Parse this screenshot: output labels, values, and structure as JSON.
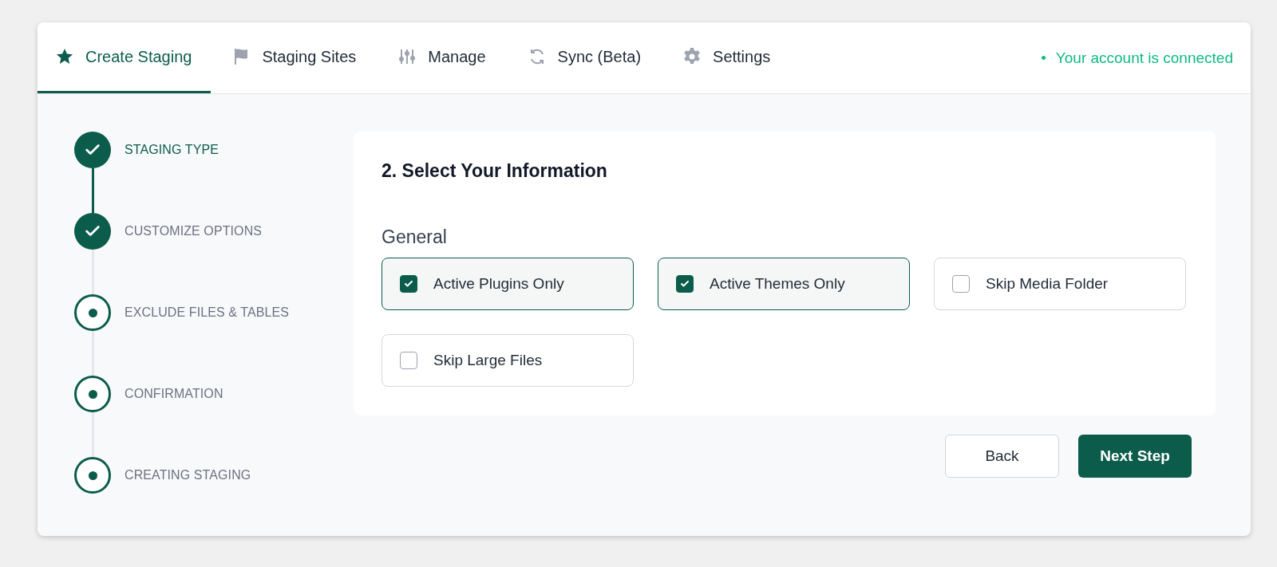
{
  "tabs": [
    {
      "label": "Create Staging",
      "selected": true
    },
    {
      "label": "Staging Sites",
      "selected": false
    },
    {
      "label": "Manage",
      "selected": false
    },
    {
      "label": "Sync (Beta)",
      "selected": false
    },
    {
      "label": "Settings",
      "selected": false
    }
  ],
  "connection_status": {
    "bullet": "•",
    "label": "Your account is connected"
  },
  "steps": [
    {
      "label": "STAGING TYPE",
      "done": true,
      "selected": true
    },
    {
      "label": "CUSTOMIZE OPTIONS",
      "done": true,
      "selected": false
    },
    {
      "label": "EXCLUDE FILES & TABLES",
      "done": false,
      "selected": false
    },
    {
      "label": "CONFIRMATION",
      "done": false,
      "selected": false
    },
    {
      "label": "CREATING STAGING",
      "done": false,
      "selected": false
    }
  ],
  "panel": {
    "title": "2. Select Your Information",
    "section": "General",
    "options": [
      {
        "label": "Active Plugins Only",
        "checked": true
      },
      {
        "label": "Active Themes Only",
        "checked": true
      },
      {
        "label": "Skip Media Folder",
        "checked": false
      },
      {
        "label": "Skip Large Files",
        "checked": false
      }
    ]
  },
  "buttons": {
    "back": "Back",
    "next": "Next Step"
  }
}
